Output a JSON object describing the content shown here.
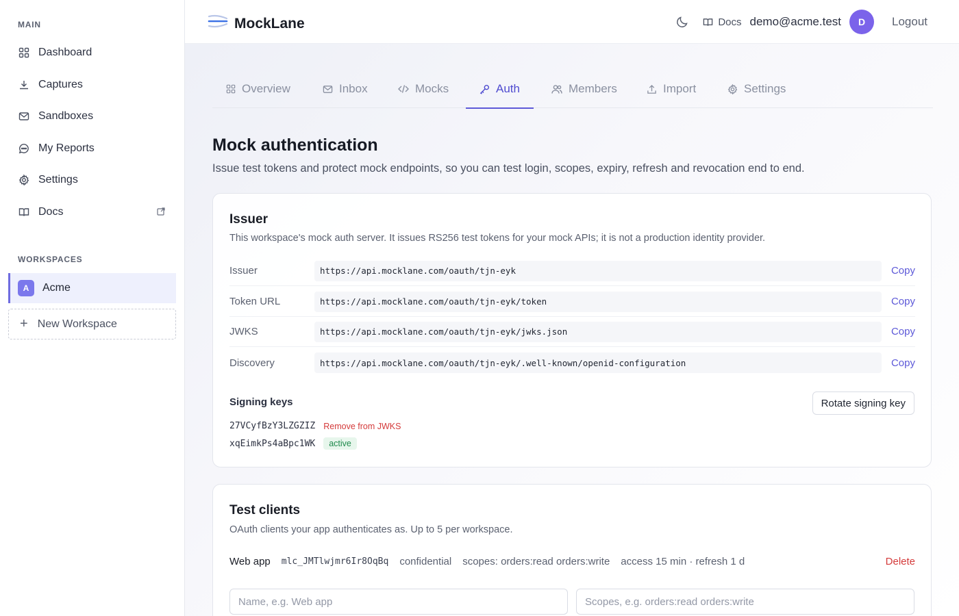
{
  "sidebar": {
    "main_title": "MAIN",
    "items": [
      {
        "label": "Dashboard",
        "icon": "grid-icon"
      },
      {
        "label": "Captures",
        "icon": "download-icon"
      },
      {
        "label": "Sandboxes",
        "icon": "mail-icon"
      },
      {
        "label": "My Reports",
        "icon": "chat-icon"
      },
      {
        "label": "Settings",
        "icon": "gear-icon"
      },
      {
        "label": "Docs",
        "icon": "book-icon"
      }
    ],
    "workspaces_title": "WORKSPACES",
    "workspace": {
      "badge": "A",
      "name": "Acme"
    },
    "new_workspace": "New Workspace"
  },
  "header": {
    "brand": "MockLane",
    "docs": "Docs",
    "email": "demo@acme.test",
    "avatar_initial": "D",
    "logout": "Logout"
  },
  "tabs": [
    {
      "label": "Overview",
      "icon": "grid-icon"
    },
    {
      "label": "Inbox",
      "icon": "mail-icon"
    },
    {
      "label": "Mocks",
      "icon": "code-icon"
    },
    {
      "label": "Auth",
      "icon": "key-icon",
      "active": true
    },
    {
      "label": "Members",
      "icon": "users-icon"
    },
    {
      "label": "Import",
      "icon": "upload-icon"
    },
    {
      "label": "Settings",
      "icon": "gear-icon"
    }
  ],
  "page": {
    "title": "Mock authentication",
    "subtitle": "Issue test tokens and protect mock endpoints, so you can test login, scopes, expiry, refresh and revocation end to end."
  },
  "issuer": {
    "title": "Issuer",
    "subtitle": "This workspace's mock auth server. It issues RS256 test tokens for your mock APIs; it is not a production identity provider.",
    "rows": [
      {
        "label": "Issuer",
        "value": "https://api.mocklane.com/oauth/tjn-eyk",
        "action": "Copy"
      },
      {
        "label": "Token URL",
        "value": "https://api.mocklane.com/oauth/tjn-eyk/token",
        "action": "Copy"
      },
      {
        "label": "JWKS",
        "value": "https://api.mocklane.com/oauth/tjn-eyk/jwks.json",
        "action": "Copy"
      },
      {
        "label": "Discovery",
        "value": "https://api.mocklane.com/oauth/tjn-eyk/.well-known/openid-configuration",
        "action": "Copy"
      }
    ],
    "signing_keys_title": "Signing keys",
    "rotate_label": "Rotate signing key",
    "keys": [
      {
        "id": "27VCyfBzY3LZGZIZ",
        "action": "Remove from JWKS"
      },
      {
        "id": "xqEimkPs4aBpc1WK",
        "status": "active"
      }
    ]
  },
  "clients": {
    "title": "Test clients",
    "subtitle": "OAuth clients your app authenticates as. Up to 5 per workspace.",
    "row": {
      "name": "Web app",
      "client_id": "mlc_JMTlwjmr6Ir8OqBq",
      "type": "confidential",
      "scopes": "scopes: orders:read orders:write",
      "ttl": "access 15 min · refresh 1 d",
      "delete": "Delete"
    },
    "name_placeholder": "Name, e.g. Web app",
    "scopes_placeholder": "Scopes, e.g. orders:read orders:write"
  },
  "colors": {
    "accent": "#5d59d8",
    "danger": "#d43a3a",
    "success": "#1f8a4c",
    "avatar": "#7b63ea"
  }
}
